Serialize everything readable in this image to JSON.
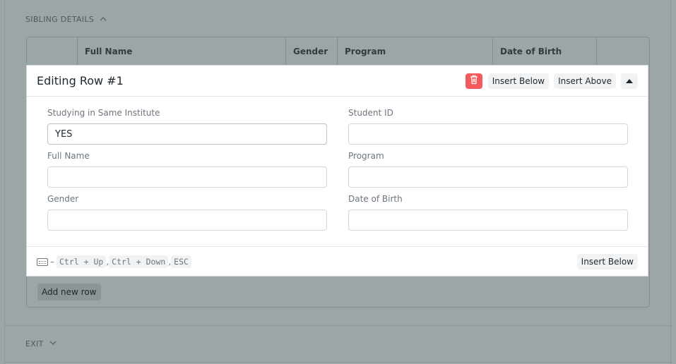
{
  "sections": {
    "sibling_details": "SIBLING DETAILS",
    "exit": "EXIT"
  },
  "grid": {
    "columns": [
      "Full Name",
      "Gender",
      "Program",
      "Date of Birth"
    ],
    "add_row_label": "Add new row"
  },
  "editor": {
    "title": "Editing Row #1",
    "insert_below_label": "Insert Below",
    "insert_above_label": "Insert Above",
    "fields": {
      "studying_same_institute": {
        "label": "Studying in Same Institute",
        "value": "YES"
      },
      "student_id": {
        "label": "Student ID",
        "value": ""
      },
      "full_name": {
        "label": "Full Name",
        "value": ""
      },
      "program": {
        "label": "Program",
        "value": ""
      },
      "gender": {
        "label": "Gender",
        "value": ""
      },
      "date_of_birth": {
        "label": "Date of Birth",
        "value": ""
      }
    },
    "shortcuts": {
      "dash": "–",
      "keys": [
        "Ctrl + Up",
        "Ctrl + Down",
        "ESC"
      ],
      "separator": ","
    },
    "footer_insert_below_label": "Insert Below"
  },
  "colors": {
    "delete_button": "#f55a5a",
    "overlay": "#9ca6a7"
  }
}
